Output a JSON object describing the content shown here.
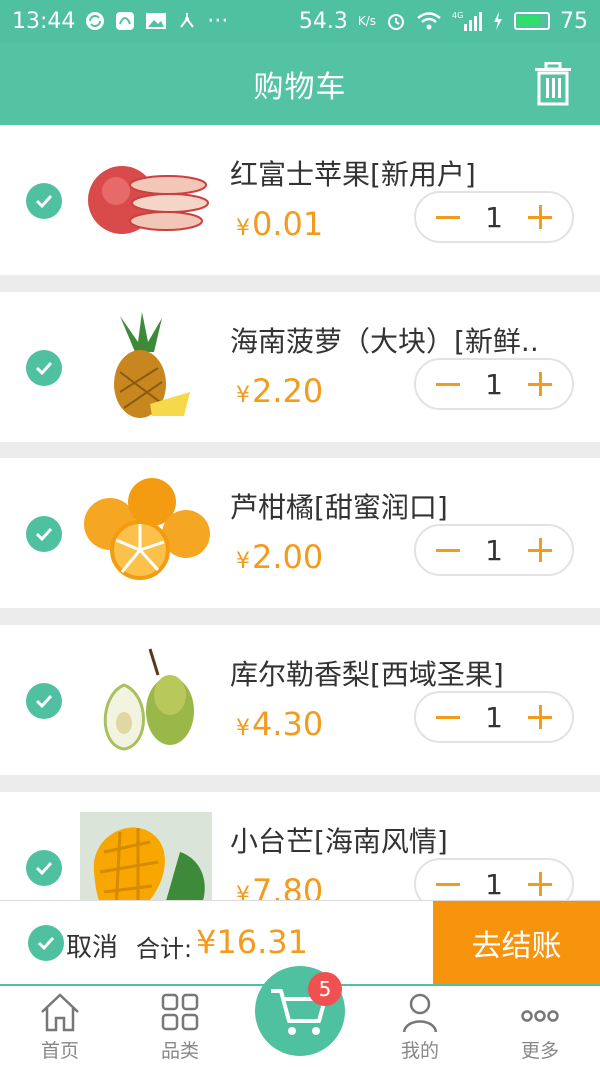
{
  "status_bar": {
    "time": "13:44",
    "net_speed": "54.3",
    "net_unit": "K/s",
    "signal_label": "4G",
    "battery_level": 75,
    "battery_text": "75",
    "more": "···"
  },
  "header": {
    "title": "购物车"
  },
  "items": [
    {
      "name": "红富士苹果[新用户]",
      "currency": "¥",
      "price": "0.01",
      "qty": "1",
      "checked": true
    },
    {
      "name": "海南菠萝（大块）[新鲜..",
      "currency": "¥",
      "price": "2.20",
      "qty": "1",
      "checked": true
    },
    {
      "name": "芦柑橘[甜蜜润口]",
      "currency": "¥",
      "price": "2.00",
      "qty": "1",
      "checked": true
    },
    {
      "name": "库尔勒香梨[西域圣果]",
      "currency": "¥",
      "price": "4.30",
      "qty": "1",
      "checked": true
    },
    {
      "name": "小台芒[海南风情]",
      "currency": "¥",
      "price": "7.80",
      "qty": "1",
      "checked": true
    }
  ],
  "cart_bar": {
    "cancel_label": "取消",
    "total_label": "合计:",
    "total_value": "¥16.31",
    "checkout_label": "去结账"
  },
  "tabbar": {
    "tabs": [
      {
        "label": "首页",
        "icon": "home-icon"
      },
      {
        "label": "品类",
        "icon": "grid-icon"
      },
      {
        "label": "",
        "icon": "cart-icon"
      },
      {
        "label": "我的",
        "icon": "user-icon"
      },
      {
        "label": "更多",
        "icon": "more-icon"
      }
    ],
    "cart_badge": "5"
  },
  "colors": {
    "primary": "#54c3a3",
    "accent": "#f39b1c",
    "checkout": "#f7930c",
    "badge": "#f05050"
  }
}
